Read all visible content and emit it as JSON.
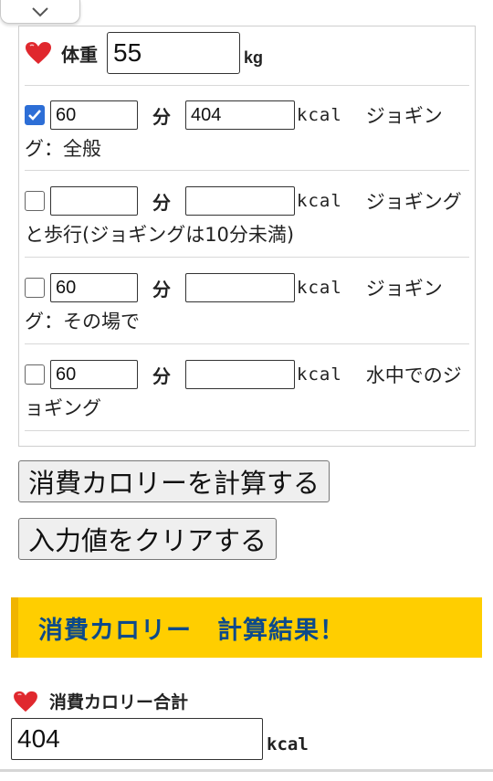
{
  "weight": {
    "label": "体重",
    "value": "55",
    "unit": "kg"
  },
  "activities": [
    {
      "checked": true,
      "minutes": "60",
      "minutes_unit": "分",
      "kcal": "404",
      "kcal_unit": "kcal",
      "name_line1": "ジョギン",
      "name_line2": "グ：全般"
    },
    {
      "checked": false,
      "minutes": "",
      "minutes_unit": "分",
      "kcal": "",
      "kcal_unit": "kcal",
      "name_line1": "ジョギング",
      "name_line2": "と歩行(ジョギングは10分未満)"
    },
    {
      "checked": false,
      "minutes": "60",
      "minutes_unit": "分",
      "kcal": "",
      "kcal_unit": "kcal",
      "name_line1": "ジョギン",
      "name_line2": "グ：その場で"
    },
    {
      "checked": false,
      "minutes": "60",
      "minutes_unit": "分",
      "kcal": "",
      "kcal_unit": "kcal",
      "name_line1": "水中でのジ",
      "name_line2": "ョギング"
    }
  ],
  "buttons": {
    "calculate": "消費カロリーを計算する",
    "clear": "入力値をクリアする"
  },
  "result": {
    "heading": "消費カロリー　計算結果！",
    "total_label": "消費カロリー合計",
    "total_value": "404",
    "total_unit": "kcal"
  },
  "colors": {
    "banner": "#ffce00",
    "banner_text": "#0d4a8a",
    "heart": "#e0282e",
    "checkbox": "#2d6ed6"
  },
  "icons": {
    "tab": "chevron-down-icon",
    "heart": "heart-icon",
    "check": "checkmark-icon"
  }
}
